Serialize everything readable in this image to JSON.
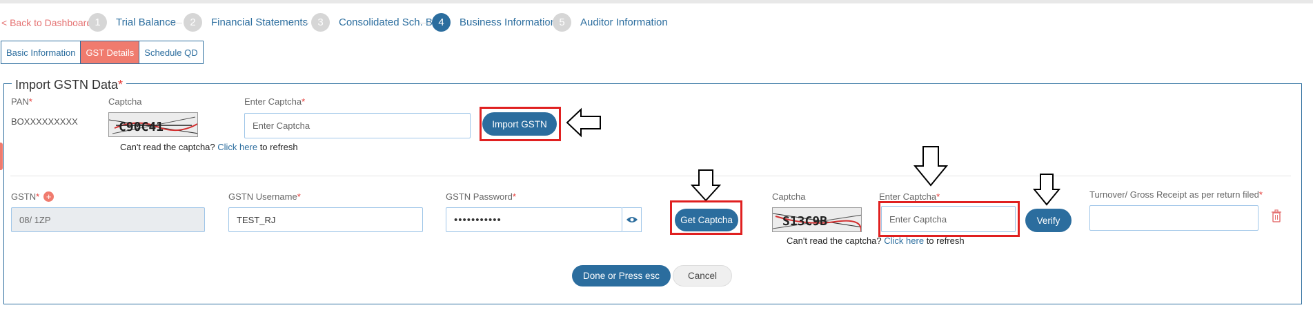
{
  "nav": {
    "back_label": "< Back to Dashboard"
  },
  "steps": [
    {
      "num": "1",
      "label": "Trial Balance",
      "active": false
    },
    {
      "num": "2",
      "label": "Financial Statements",
      "active": false
    },
    {
      "num": "3",
      "label": "Consolidated Sch. BP",
      "active": false
    },
    {
      "num": "4",
      "label": "Business Information",
      "active": true
    },
    {
      "num": "5",
      "label": "Auditor Information",
      "active": false
    }
  ],
  "tabs": [
    {
      "label": "Basic Information",
      "active": false
    },
    {
      "label": "GST Details",
      "active": true
    },
    {
      "label": "Schedule QD",
      "active": false
    }
  ],
  "import": {
    "title": "Import GSTN Data",
    "required_mark": "*",
    "pan_label": "PAN",
    "pan_value": "BOXXXXXXXXX",
    "captcha_label": "Captcha",
    "enter_captcha_label": "Enter Captcha",
    "enter_captcha_placeholder": "Enter Captcha",
    "import_button": "Import GSTN",
    "refresh_prefix": "Can't read the captcha?",
    "refresh_link": "Click here",
    "refresh_suffix": "to refresh"
  },
  "gstn": {
    "gstn_label": "GSTN",
    "gstn_value": "08/ 1ZP",
    "username_label": "GSTN Username",
    "username_value": "TEST_RJ",
    "password_label": "GSTN Password",
    "password_value": "•••••••••••",
    "get_captcha_button": "Get Captcha",
    "captcha_label": "Captcha",
    "enter_captcha_label": "Enter Captcha",
    "enter_captcha_placeholder": "Enter Captcha",
    "verify_button": "Verify",
    "turnover_label": "Turnover/ Gross Receipt as per return filed",
    "refresh_prefix": "Can't read the captcha?",
    "refresh_link": "Click here",
    "refresh_suffix": "to refresh"
  },
  "footer": {
    "done_button": "Done or Press esc",
    "cancel_button": "Cancel"
  },
  "colors": {
    "primary": "#2b6d9e",
    "accent": "#f07b6e",
    "required": "#e53935",
    "highlight": "#e02020"
  }
}
